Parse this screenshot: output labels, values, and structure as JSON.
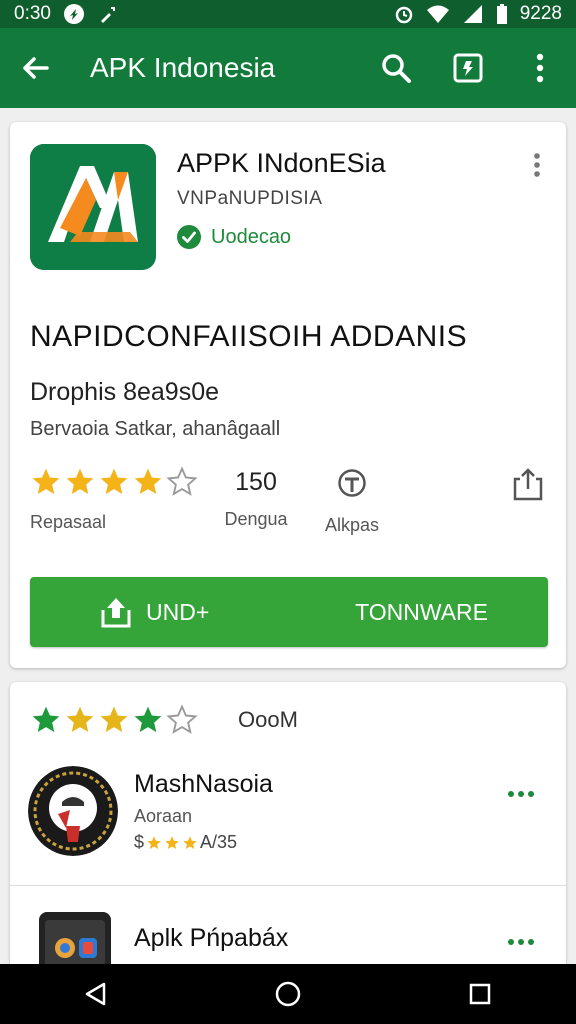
{
  "status_bar": {
    "time": "0:30",
    "clock": "9228",
    "icons": [
      "notification-icon",
      "tool-icon",
      "alarm-icon",
      "wifi-icon",
      "signal-icon",
      "battery-icon"
    ]
  },
  "app_bar": {
    "title": "APK Indonesia",
    "icons": [
      "back-arrow-icon",
      "search-icon",
      "bookmark-icon",
      "more-vert-icon"
    ]
  },
  "app": {
    "name": "APPK INdonESia",
    "developer": "VNPaNUPDISIA",
    "verified_label": "Uodecao",
    "headline": "NAPIDCONFAIISOIH ADDANIS",
    "subline": "Drophis 8ea9s0e",
    "meta": "Bervaoia Satkar, ahanâgaall",
    "rating_stars": 4,
    "rating_label": "Repasaal",
    "count_value": "150",
    "count_label": "Dengua",
    "age_label": "Alkpas",
    "install_left": "UND+",
    "install_right": "TONNWARE"
  },
  "reviews": {
    "summary_stars": 4,
    "summary_count": "OooM",
    "items": [
      {
        "name": "MashNasoia",
        "subtitle": "Aoraan",
        "line_prefix": "$",
        "line_stars": 3,
        "line_suffix": "A/35"
      },
      {
        "name": "Aplk Pńpabáx"
      }
    ]
  },
  "colors": {
    "status_bar": "#0f5e2e",
    "app_bar": "#127a3b",
    "install": "#35a53a",
    "star": "#f5b31a",
    "review_star": "#1e9a3c",
    "verified": "#1e8a3c"
  },
  "nav_bar": {
    "icons": [
      "back-triangle-icon",
      "home-circle-icon",
      "recents-square-icon"
    ]
  }
}
